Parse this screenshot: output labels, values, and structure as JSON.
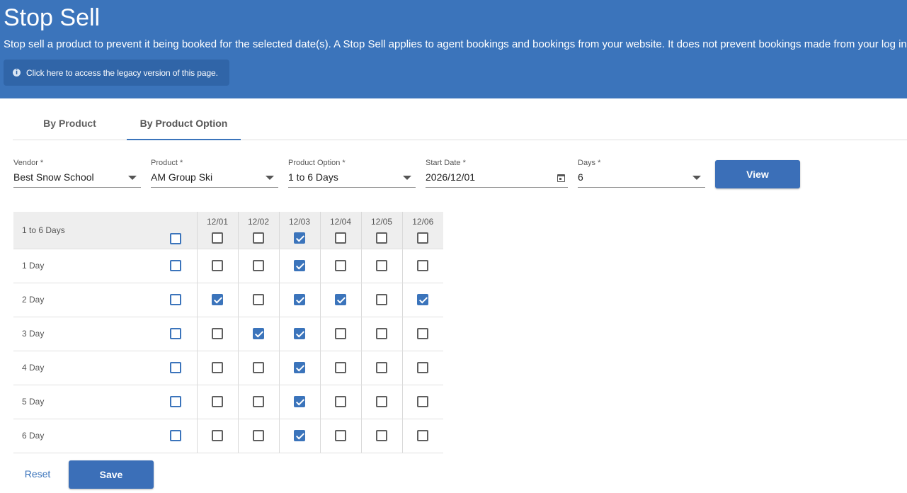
{
  "header": {
    "title": "Stop Sell",
    "description": "Stop sell a product to prevent it being booked for the selected date(s). A Stop Sell applies to agent bookings and bookings from your website. It does not prevent bookings made from your log in.",
    "legacy_label": "Click here to access the legacy version of this page.",
    "legacy_icon": "info-icon"
  },
  "tabs": [
    {
      "label": "By Product",
      "active": false
    },
    {
      "label": "By Product Option",
      "active": true
    }
  ],
  "filters": {
    "vendor": {
      "label": "Vendor *",
      "value": "Best Snow School"
    },
    "product": {
      "label": "Product *",
      "value": "AM Group Ski"
    },
    "product_option": {
      "label": "Product Option *",
      "value": "1 to 6 Days"
    },
    "start_date": {
      "label": "Start Date *",
      "value": "2026/12/01"
    },
    "days": {
      "label": "Days *",
      "value": "6"
    },
    "view_label": "View"
  },
  "grid": {
    "header_label": "1 to 6 Days",
    "dates": [
      "12/01",
      "12/02",
      "12/03",
      "12/04",
      "12/05",
      "12/06"
    ],
    "header_checked": [
      false,
      false,
      true,
      false,
      false,
      false
    ],
    "rows": [
      {
        "label": "1 Day",
        "checked": [
          false,
          false,
          true,
          false,
          false,
          false
        ]
      },
      {
        "label": "2 Day",
        "checked": [
          true,
          false,
          true,
          true,
          false,
          true
        ]
      },
      {
        "label": "3 Day",
        "checked": [
          false,
          true,
          true,
          false,
          false,
          false
        ]
      },
      {
        "label": "4 Day",
        "checked": [
          false,
          false,
          true,
          false,
          false,
          false
        ]
      },
      {
        "label": "5 Day",
        "checked": [
          false,
          false,
          true,
          false,
          false,
          false
        ]
      },
      {
        "label": "6 Day",
        "checked": [
          false,
          false,
          true,
          false,
          false,
          false
        ]
      }
    ]
  },
  "actions": {
    "reset_label": "Reset",
    "save_label": "Save"
  },
  "colors": {
    "header_bg": "#3b74bb",
    "accent": "#3b74bb",
    "button_bg": "#3b6fb8"
  }
}
